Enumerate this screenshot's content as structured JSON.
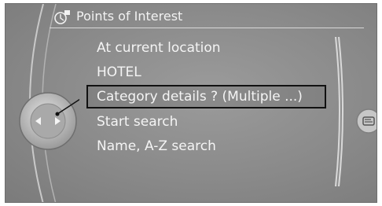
{
  "header": {
    "title": "Points of Interest",
    "icon": "poi-icon"
  },
  "menu": {
    "items": [
      {
        "label": "At current location"
      },
      {
        "label": "HOTEL"
      },
      {
        "label": "Category details  ? (Multiple ...)"
      },
      {
        "label": "Start search"
      },
      {
        "label": "Name, A-Z search"
      }
    ],
    "selected_index": 2
  },
  "controller": {
    "icon": "controller-knob-icon"
  },
  "side_button": {
    "icon": "options-button-icon"
  },
  "colors": {
    "background": "#8a8a8a",
    "text": "#f4f4f4",
    "highlight_border": "#111111"
  }
}
